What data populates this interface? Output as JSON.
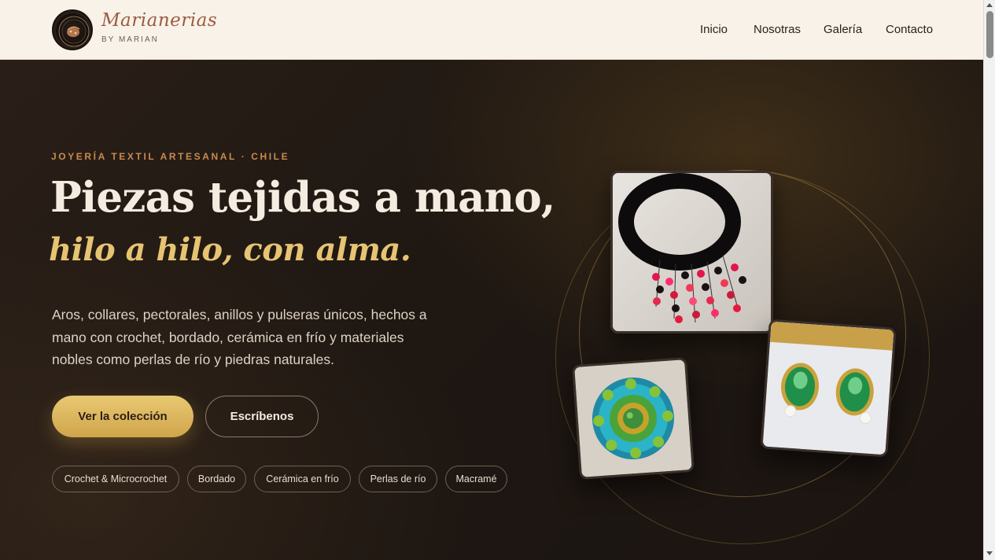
{
  "header": {
    "brand_name": "Marianerias",
    "brand_sub": "BY MARIAN",
    "nav": [
      {
        "label": "Inicio"
      },
      {
        "label": "Nosotras"
      },
      {
        "label": "Galería"
      },
      {
        "label": "Contacto"
      }
    ]
  },
  "hero": {
    "eyebrow": "JOYERÍA TEXTIL ARTESANAL · CHILE",
    "title_line1": "Piezas tejidas a mano,",
    "title_line2": "hilo a hilo, con alma.",
    "lead": "Aros, collares, pectorales, anillos y pulseras únicos, hechos a mano con crochet, bordado, cerámica en frío y materiales nobles como perlas de río y piedras naturales.",
    "primary_button": "Ver la colección",
    "secondary_button": "Escríbenos",
    "chips": [
      {
        "label": "Crochet & Microcrochet"
      },
      {
        "label": "Bordado"
      },
      {
        "label": "Cerámica en frío"
      },
      {
        "label": "Perlas de río"
      },
      {
        "label": "Macramé"
      }
    ]
  },
  "colors": {
    "accent_gold": "#e6c472",
    "eyebrow_orange": "#c98a4e",
    "header_bg": "#f8f2e9",
    "hero_bg": "#1e1712"
  }
}
